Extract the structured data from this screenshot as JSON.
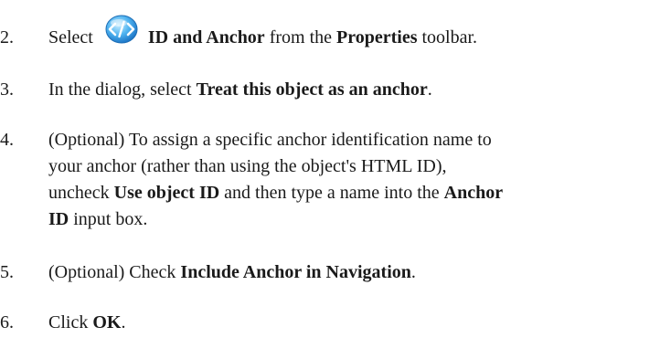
{
  "steps": [
    {
      "number": "2.",
      "pre": "Select",
      "icon": "id-anchor-icon",
      "bold1": "ID and Anchor",
      "mid": "from the",
      "bold2": "Properties",
      "post": "toolbar."
    },
    {
      "number": "3.",
      "pre": "In the dialog, select",
      "bold1": "Treat this object as an anchor",
      "post": "."
    },
    {
      "number": "4.",
      "line1": "(Optional) To assign a specific anchor identification name to",
      "line2": "your anchor (rather than using the object's HTML ID),",
      "line3_pre": "uncheck",
      "line3_bold1": "Use object ID",
      "line3_mid": "and then type a name into the",
      "line3_bold2": "Anchor",
      "line4_bold": "ID",
      "line4_post": "input box."
    },
    {
      "number": "5.",
      "pre": "(Optional) Check",
      "bold1": "Include Anchor in Navigation",
      "post": "."
    },
    {
      "number": "6.",
      "pre": "Click",
      "bold1": "OK",
      "post": "."
    }
  ],
  "colors": {
    "icon_blue": "#3aa0e8",
    "icon_light": "#8fd0ff",
    "text": "#1a1a1a"
  }
}
